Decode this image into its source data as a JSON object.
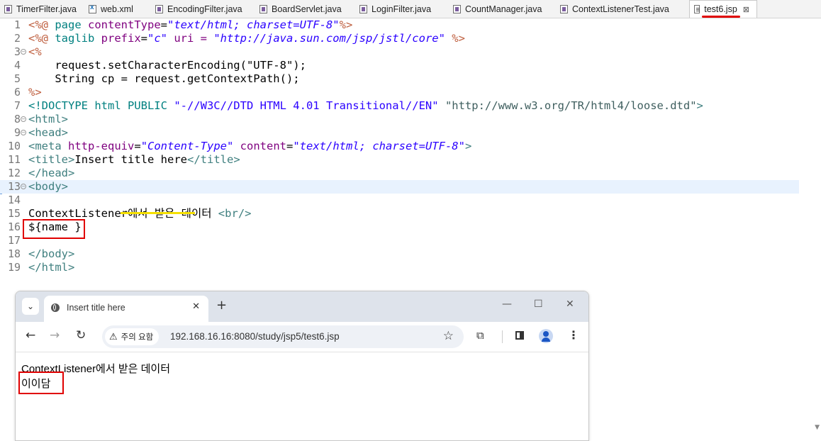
{
  "tabs": [
    {
      "label": "TimerFilter.java",
      "icon": "java-file-icon"
    },
    {
      "label": "web.xml",
      "icon": "xml-file-icon"
    },
    {
      "label": "EncodingFilter.java",
      "icon": "java-file-icon"
    },
    {
      "label": "BoardServlet.java",
      "icon": "java-file-icon"
    },
    {
      "label": "LoginFilter.java",
      "icon": "java-file-icon"
    },
    {
      "label": "CountManager.java",
      "icon": "java-file-icon"
    },
    {
      "label": "ContextListenerTest.java",
      "icon": "java-file-icon"
    },
    {
      "label": "test6.jsp",
      "icon": "jsp-file-icon",
      "active": true,
      "close": "⊠"
    }
  ],
  "editor": {
    "lines": [
      {
        "n": "1",
        "fold": false
      },
      {
        "n": "2",
        "fold": false
      },
      {
        "n": "3",
        "fold": true
      },
      {
        "n": "4",
        "fold": false
      },
      {
        "n": "5",
        "fold": false
      },
      {
        "n": "6",
        "fold": false
      },
      {
        "n": "7",
        "fold": false
      },
      {
        "n": "8",
        "fold": true
      },
      {
        "n": "9",
        "fold": true
      },
      {
        "n": "10",
        "fold": false
      },
      {
        "n": "11",
        "fold": false
      },
      {
        "n": "12",
        "fold": false
      },
      {
        "n": "13",
        "fold": true,
        "highlight": true
      },
      {
        "n": "14",
        "fold": false
      },
      {
        "n": "15",
        "fold": false
      },
      {
        "n": "16",
        "fold": false
      },
      {
        "n": "17",
        "fold": false
      },
      {
        "n": "18",
        "fold": false
      },
      {
        "n": "19",
        "fold": false
      }
    ],
    "code": {
      "l1": [
        "<%@ ",
        "page ",
        "contentType",
        "=",
        "\"text/html; charset=UTF-8\"",
        "%>"
      ],
      "l2": [
        "<%@ ",
        "taglib ",
        "prefix",
        "=",
        "\"c\"",
        " uri = ",
        "\"http://java.sun.com/jsp/jstl/core\"",
        " %>"
      ],
      "l3": "<%",
      "l4": "    request.setCharacterEncoding(\"UTF-8\");",
      "l5": "    String cp = request.getContextPath();",
      "l6": "%>",
      "l7": [
        "<!DOCTYPE html PUBLIC ",
        "\"-//W3C//DTD HTML 4.01 Transitional//EN\"",
        " ",
        "\"http://www.w3.org/TR/html4/loose.dtd\"",
        ">"
      ],
      "l8": [
        "<",
        "html",
        ">"
      ],
      "l9": [
        "<",
        "head",
        ">"
      ],
      "l10": [
        "<",
        "meta ",
        "http-equiv",
        "=",
        "\"Content-Type\"",
        " content",
        "=",
        "\"text/html; charset=UTF-8\"",
        ">"
      ],
      "l11": [
        "<",
        "title",
        ">",
        "Insert title here",
        "</",
        "title",
        ">"
      ],
      "l12": [
        "</",
        "head",
        ">"
      ],
      "l13": [
        "<",
        "body",
        ">"
      ],
      "l15": [
        "ContextListener에서 받은 데이터 ",
        "<",
        "br",
        "/>"
      ],
      "l16": "${name }",
      "l18": [
        "</",
        "body",
        ">"
      ],
      "l19": [
        "</",
        "html",
        ">"
      ]
    }
  },
  "browser": {
    "tab_title": "Insert title here",
    "close_glyph": "✕",
    "new_tab_glyph": "+",
    "window_controls": {
      "minimize": "—",
      "maximize": "☐",
      "close": "✕"
    },
    "security_label": "주의 요함",
    "url": "192.168.16.16:8080/study/jsp5/test6.jsp",
    "content": {
      "line1": "ContextListener에서 받은 데이터",
      "line2": "이이담"
    }
  },
  "colors": {
    "annotation_red": "#e00000",
    "highlight_yellow": "#f5e000",
    "line_highlight": "#e8f2fe"
  }
}
